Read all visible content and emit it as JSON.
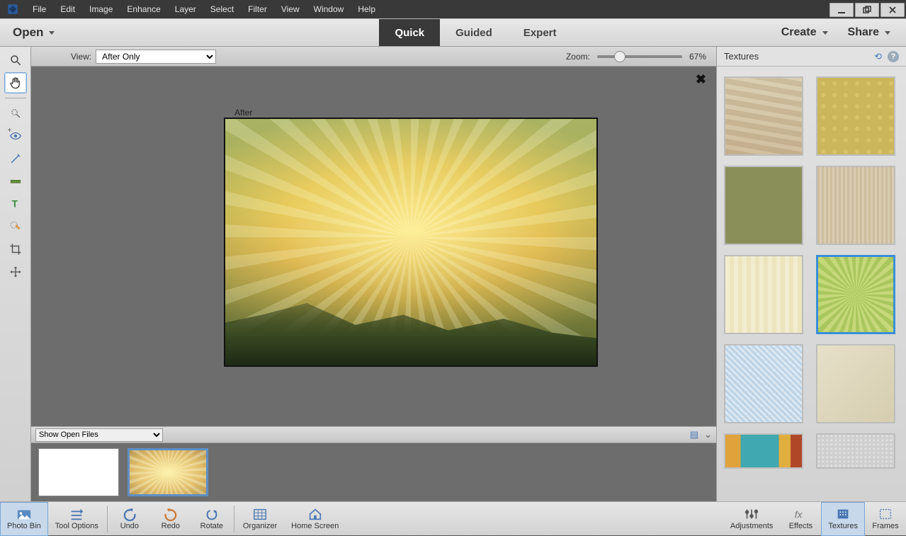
{
  "menus": [
    "File",
    "Edit",
    "Image",
    "Enhance",
    "Layer",
    "Select",
    "Filter",
    "View",
    "Window",
    "Help"
  ],
  "modebar": {
    "open": "Open",
    "tabs": [
      "Quick",
      "Guided",
      "Expert"
    ],
    "create": "Create",
    "share": "Share"
  },
  "viewbar": {
    "view_label": "View:",
    "view_value": "After Only",
    "zoom_label": "Zoom:",
    "zoom_value": "67%"
  },
  "canvas": {
    "after_label": "After"
  },
  "binbar": {
    "dropdown": "Show Open Files"
  },
  "rpanel": {
    "title": "Textures"
  },
  "bottom": {
    "photobin": "Photo Bin",
    "toolopts": "Tool Options",
    "undo": "Undo",
    "redo": "Redo",
    "rotate": "Rotate",
    "organizer": "Organizer",
    "home": "Home Screen",
    "adjustments": "Adjustments",
    "effects": "Effects",
    "textures": "Textures",
    "frames": "Frames"
  }
}
